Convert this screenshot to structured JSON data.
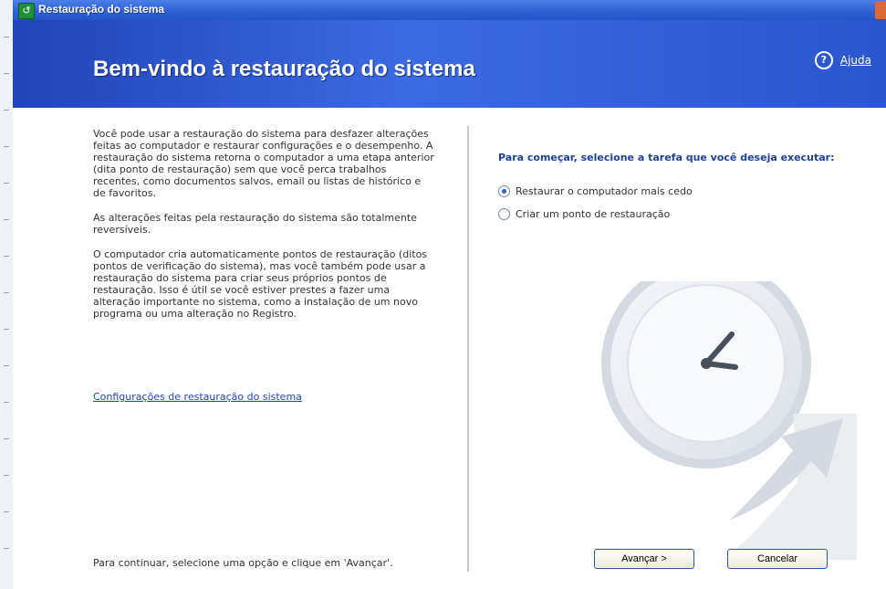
{
  "window": {
    "title": "Restauração do sistema",
    "header_title": "Bem-vindo à restauração do sistema",
    "help_label": "Ajuda"
  },
  "left_panel": {
    "paragraphs": [
      "Você pode usar a restauração do sistema para desfazer alterações feitas ao computador e restaurar configurações e o desempenho. A restauração do sistema retorna o computador a uma etapa anterior (dita ponto de restauração) sem que você perca trabalhos recentes, como documentos salvos, email ou listas de histórico e de favoritos.",
      "As alterações feitas pela restauração do sistema são totalmente reversíveis.",
      "O computador cria automaticamente pontos de restauração (ditos pontos de verificação do sistema), mas você também pode usar a restauração do sistema para criar seus próprios pontos de restauração. Isso é útil se você estiver prestes a fazer uma alteração importante no sistema, como a instalação de um novo programa ou uma alteração no Registro."
    ],
    "settings_link": "Configurações de restauração do sistema",
    "footer_hint": "Para continuar, selecione uma opção e clique em 'Avançar'."
  },
  "right_panel": {
    "prompt": "Para começar, selecione a tarefa que você deseja executar:",
    "options": [
      "Restaurar o computador mais cedo",
      "Criar um ponto de restauração"
    ]
  },
  "buttons": {
    "next": "Avançar >",
    "cancel": "Cancelar"
  },
  "colors": {
    "titlebar": "#2d5fd4",
    "header": "#3c6ae0",
    "link": "#1a49b8"
  },
  "icons": {
    "title_icon": "system-restore-icon",
    "help_icon": "help-icon",
    "decorative": "clock-arrow-icon"
  }
}
